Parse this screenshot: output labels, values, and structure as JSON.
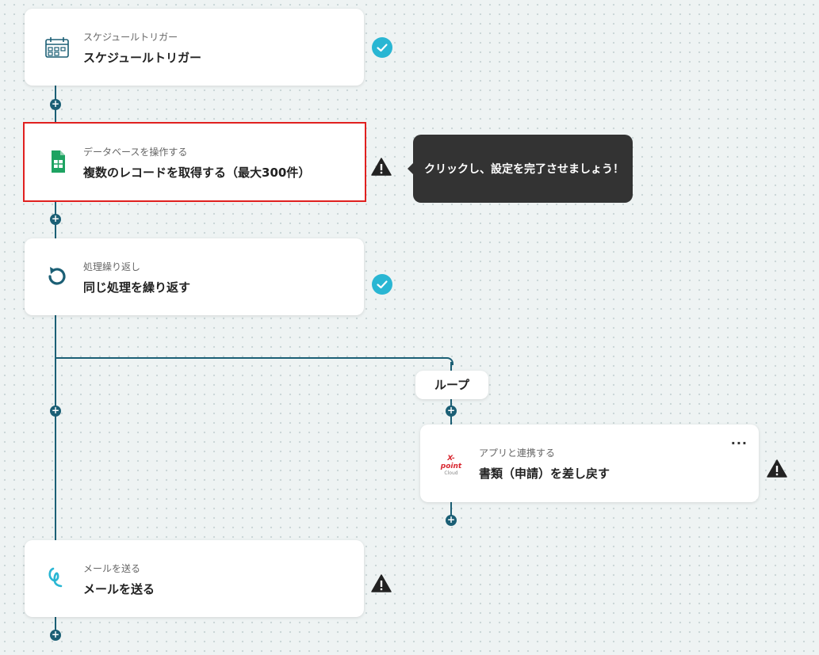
{
  "steps": [
    {
      "subtitle": "スケジュールトリガー",
      "title": "スケジュールトリガー",
      "icon": "calendar-schedule-icon",
      "status": "complete"
    },
    {
      "subtitle": "データベースを操作する",
      "title": "複数のレコードを取得する（最大300件）",
      "icon": "google-sheets-icon",
      "status": "warning"
    },
    {
      "subtitle": "処理繰り返し",
      "title": "同じ処理を繰り返す",
      "icon": "loop-arrow-icon",
      "status": "complete"
    },
    {
      "subtitle": "アプリと連携する",
      "title": "書類（申請）を差し戻す",
      "icon": "xpoint-cloud-logo",
      "status": "warning"
    },
    {
      "subtitle": "メールを送る",
      "title": "メールを送る",
      "icon": "mail-script-icon",
      "status": "warning"
    }
  ],
  "tooltip": "クリックし、設定を完了させましょう！",
  "loop_label": "ループ",
  "xpoint_logo_text": "X-point",
  "xpoint_logo_sub": "Cloud",
  "more_menu": "...",
  "colors": {
    "line": "#1b5f75",
    "check": "#29b6d3",
    "selected_border": "#e0201f",
    "tooltip_bg": "#333333"
  }
}
